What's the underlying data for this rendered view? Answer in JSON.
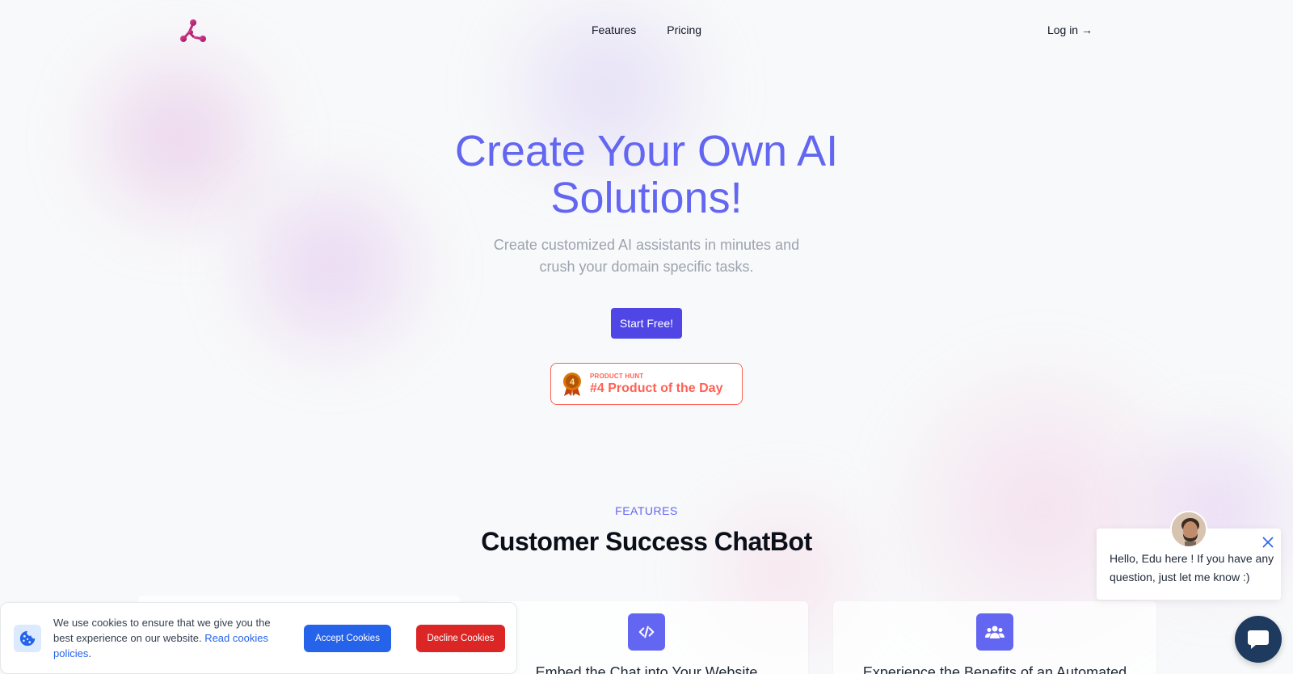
{
  "nav": {
    "links": [
      "Features",
      "Pricing"
    ],
    "login": "Log in →"
  },
  "hero": {
    "title_line1": "Create Your Own AI",
    "title_line2": "Solutions!",
    "subtitle": "Create customized AI assistants in minutes and crush your domain specific tasks.",
    "cta": "Start Free!",
    "badge": {
      "small": "PRODUCT HUNT",
      "big": "#4 Product of the Day",
      "medal_number": "4"
    }
  },
  "features": {
    "label": "FEATURES",
    "title": "Customer Success ChatBot",
    "cards": [
      {
        "icon": "code-icon",
        "title": "Embed the Chat into Your Website"
      },
      {
        "icon": "users-icon",
        "title": "Experience the Benefits of an Automated"
      }
    ]
  },
  "cookie": {
    "text": "We use cookies to ensure that we give you the best experience on our website.",
    "link": "Read cookies policies",
    "period": ".",
    "accept": "Accept Cookies",
    "decline": "Decline Cookies"
  },
  "chat": {
    "message": "Hello, Edu here ! If you have any question, just let me know :)"
  },
  "colors": {
    "accent": "#6366f1",
    "cta": "#4f46e5",
    "producthunt": "#ff6154",
    "accept": "#2563eb",
    "decline": "#dc2626"
  }
}
